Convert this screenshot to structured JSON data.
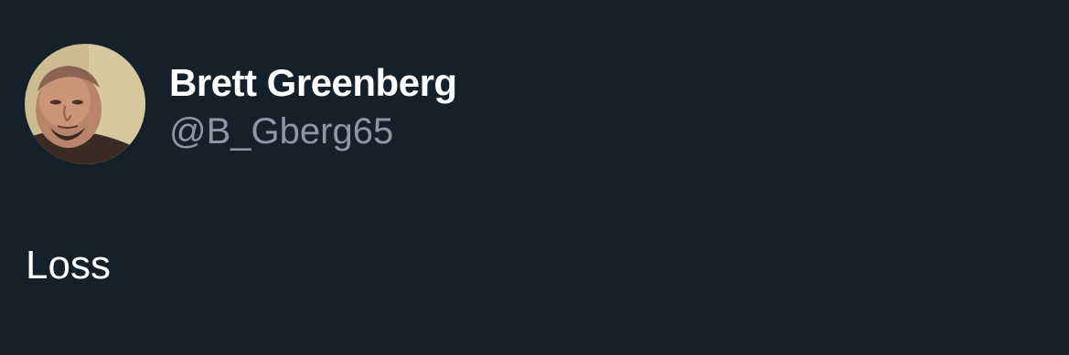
{
  "tweet": {
    "author": {
      "display_name": "Brett Greenberg",
      "handle": "@B_Gberg65",
      "avatar": "profile-photo"
    },
    "text": "Loss"
  },
  "colors": {
    "background": "#15202b",
    "name_text": "#ffffff",
    "handle_text": "#8b98a5",
    "body_text": "#ffffff"
  }
}
